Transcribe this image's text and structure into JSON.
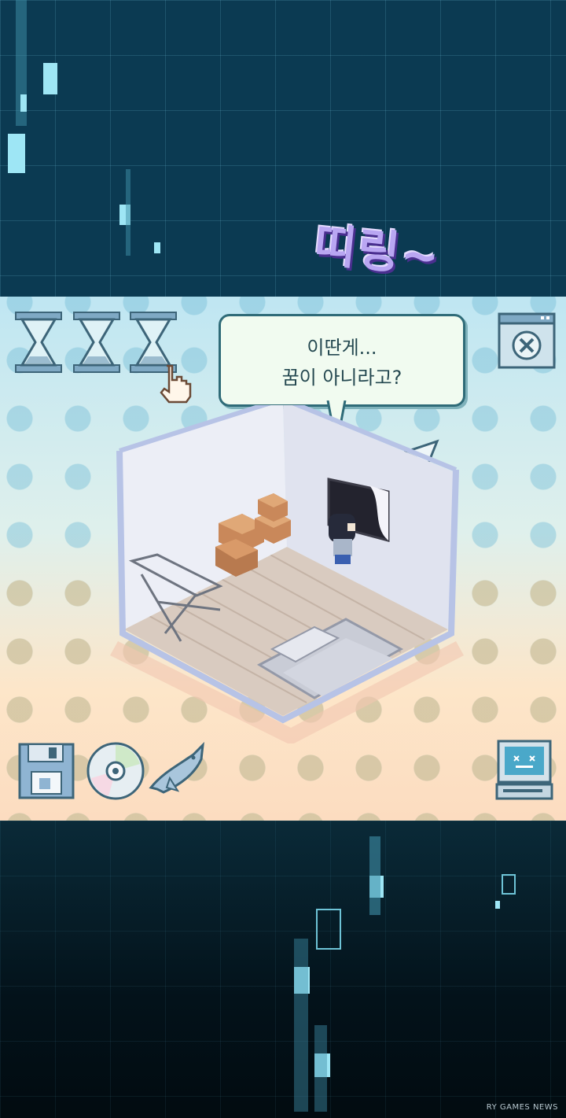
{
  "sound_effect": "띠링~",
  "speech_bubble": {
    "line1": "이딴게...",
    "line2": "꿈이 아니라고?"
  },
  "hud": {
    "hourglass_count": 3,
    "left_icons": [
      "floppy-disk-icon",
      "cd-disc-icon",
      "dolphin-icon"
    ],
    "right_icon": "computer-icon",
    "close_icon": "window-close-icon"
  },
  "colors": {
    "panel_accent": "#2f6b78",
    "bubble_bg": "#f1fbf0",
    "sfx": "#b9a6f2"
  },
  "watermark": "RY GAMES NEWS"
}
